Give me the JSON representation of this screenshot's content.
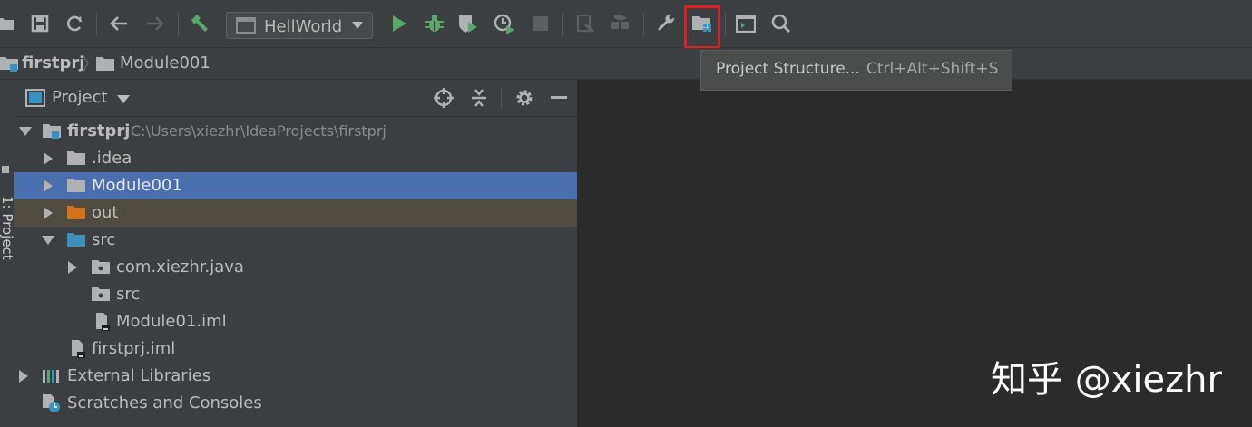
{
  "toolbar": {
    "run_config": "HellWorld",
    "icons": [
      "open-folder-icon",
      "save-icon",
      "sync-icon",
      "back-icon",
      "forward-icon",
      "build-hammer-icon",
      "run-icon",
      "debug-icon",
      "coverage-icon",
      "profile-icon",
      "stop-icon",
      "attach-icon",
      "package-icon",
      "settings-wrench-icon",
      "project-structure-icon",
      "terminal-icon",
      "search-icon"
    ]
  },
  "tooltip": {
    "label": "Project Structure...",
    "shortcut": "Ctrl+Alt+Shift+S"
  },
  "breadcrumb": [
    "firstprj",
    "Module001"
  ],
  "side_tab": "1: Project",
  "panel": {
    "title": "Project"
  },
  "tree": [
    {
      "label": "firstprj",
      "path": "C:\\Users\\xiezhr\\IdeaProjects\\firstprj",
      "depth": 0,
      "icon": "module-icon",
      "expanded": true,
      "bold": true
    },
    {
      "label": ".idea",
      "depth": 1,
      "icon": "folder-icon",
      "expanded": false
    },
    {
      "label": "Module001",
      "depth": 1,
      "icon": "folder-icon",
      "expanded": false,
      "selected": true
    },
    {
      "label": "out",
      "depth": 1,
      "icon": "excluded-folder-icon",
      "expanded": false,
      "excluded": true
    },
    {
      "label": "src",
      "depth": 1,
      "icon": "source-folder-icon",
      "expanded": true
    },
    {
      "label": "com.xiezhr.java",
      "depth": 2,
      "icon": "package-folder-icon",
      "expanded": false
    },
    {
      "label": "src",
      "depth": 2,
      "icon": "package-folder-icon"
    },
    {
      "label": "Module01.iml",
      "depth": 2,
      "icon": "iml-file-icon"
    },
    {
      "label": "firstprj.iml",
      "depth": 1,
      "icon": "iml-file-icon"
    },
    {
      "label": "External Libraries",
      "depth": 0,
      "icon": "libraries-icon",
      "expanded": false
    },
    {
      "label": "Scratches and Consoles",
      "depth": 0,
      "icon": "scratches-icon"
    }
  ],
  "colors": {
    "selected_row": "#4b6eaf",
    "excluded_row": "#4f4b41",
    "highlight": "#e02020",
    "run_green": "#59a869"
  },
  "watermark": "知乎 @xiezhr"
}
